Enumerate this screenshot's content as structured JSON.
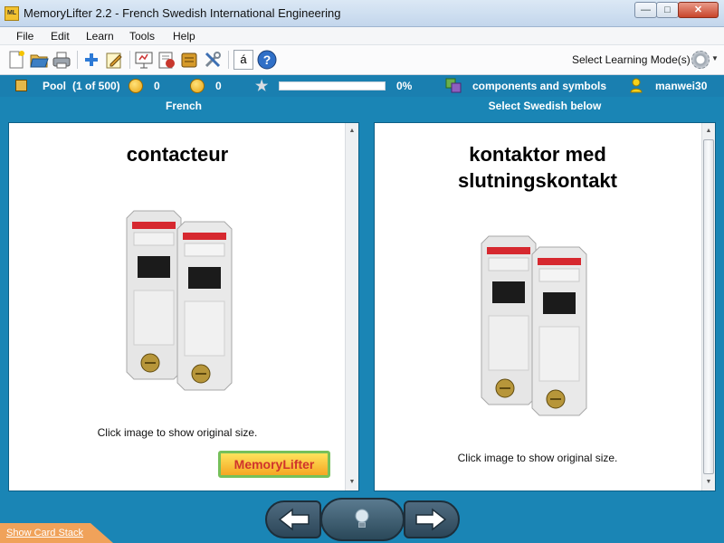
{
  "window": {
    "app_icon_text": "ML",
    "title": "MemoryLifter 2.2 - French Swedish International Engineering"
  },
  "menu": [
    "File",
    "Edit",
    "Learn",
    "Tools",
    "Help"
  ],
  "toolbar": {
    "icons": [
      "new-icon",
      "open-icon",
      "print-icon",
      "add-icon",
      "edit-icon",
      "presentation-icon",
      "statistics-icon",
      "box-icon",
      "settings-tools-icon",
      "character-map-icon",
      "help-icon"
    ],
    "character_key": "á",
    "learning_mode_label": "Select Learning Mode(s)"
  },
  "status": {
    "pool_label": "Pool",
    "pool_count": "(1 of 500)",
    "correct_count": "0",
    "wrong_count": "0",
    "progress_percent": "0%",
    "progress_value": 0,
    "chapter": "components and symbols",
    "user": "manwei30"
  },
  "question": {
    "header": "French",
    "word": "contacteur",
    "image_hint": "Click image to show original size.",
    "logo_text": "MemoryLifter"
  },
  "answer": {
    "header": "Select Swedish below",
    "word_line1": "kontaktor med",
    "word_line2": "slutningskontakt",
    "image_hint": "Click image to show original size."
  },
  "footer": {
    "card_stack_link": "Show Card Stack"
  },
  "colors": {
    "main_bg": "#1a85b5",
    "progress_fill": "#5fb043",
    "logo_text": "#d0342c"
  }
}
